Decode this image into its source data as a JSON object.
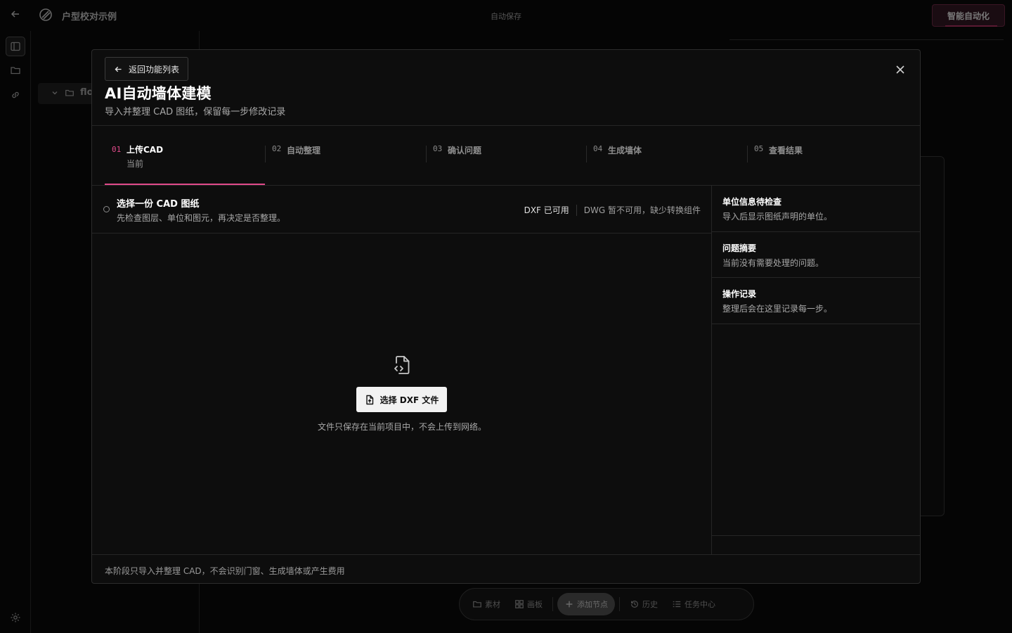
{
  "app": {
    "project_title": "户型校对示例",
    "autosave_label": "自动保存",
    "automation_button": "智能自动化",
    "tree_item": "flo",
    "bottom_toolbar": {
      "materials": "素材",
      "canvas": "画板",
      "add_node": "添加节点",
      "history": "历史",
      "tasks": "任务中心"
    }
  },
  "modal": {
    "back_label": "返回功能列表",
    "title": "AI自动墙体建模",
    "subtitle": "导入并整理 CAD 图纸，保留每一步修改记录",
    "steps": [
      {
        "num": "01",
        "label": "上传CAD",
        "status": "当前"
      },
      {
        "num": "02",
        "label": "自动整理"
      },
      {
        "num": "03",
        "label": "确认问题"
      },
      {
        "num": "04",
        "label": "生成墙体"
      },
      {
        "num": "05",
        "label": "查看结果"
      }
    ],
    "select": {
      "title": "选择一份 CAD 图纸",
      "desc": "先检查图层、单位和图元，再决定是否整理。",
      "dxf_status": "DXF 已可用",
      "dwg_status": "DWG 暂不可用，缺少转换组件"
    },
    "dropzone": {
      "button_label": "选择 DXF 文件",
      "note": "文件只保存在当前项目中，不会上传到网络。"
    },
    "side_panel": [
      {
        "title": "单位信息待检查",
        "desc": "导入后显示图纸声明的单位。"
      },
      {
        "title": "问题摘要",
        "desc": "当前没有需要处理的问题。"
      },
      {
        "title": "操作记录",
        "desc": "整理后会在这里记录每一步。"
      }
    ],
    "footer_note": "本阶段只导入并整理 CAD，不会识别门窗、生成墙体或产生费用"
  },
  "colors": {
    "accent": "#e04a8a",
    "background": "#050505",
    "modal_bg": "#0d0d0d"
  }
}
